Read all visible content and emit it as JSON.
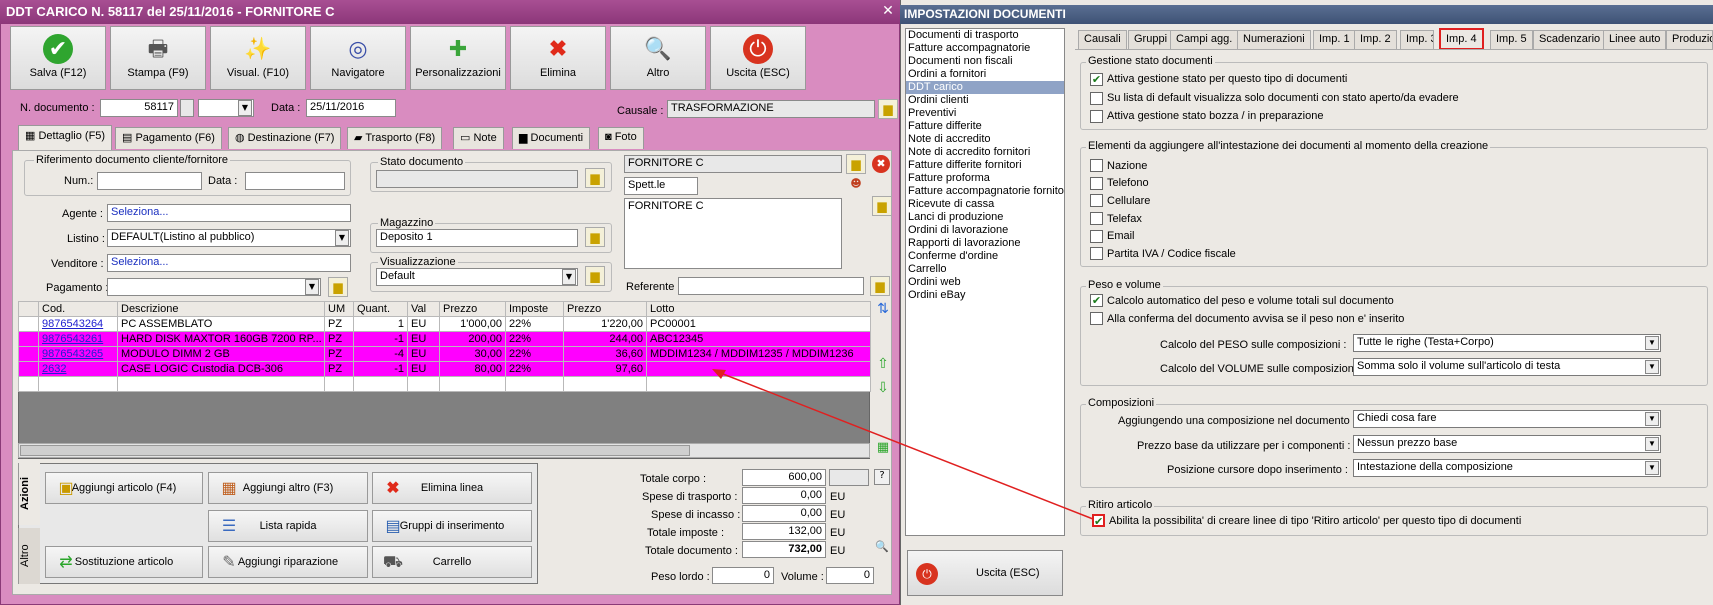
{
  "left": {
    "title": "DDT CARICO N. 58117 del 25/11/2016 - FORNITORE C",
    "close": "✕",
    "toolbar": [
      {
        "label": "Salva (F12)",
        "icon": "check-icon"
      },
      {
        "label": "Stampa (F9)",
        "icon": "printer-icon"
      },
      {
        "label": "Visual. (F10)",
        "icon": "wand-icon"
      },
      {
        "label": "Navigatore",
        "icon": "compass-icon"
      },
      {
        "label": "Personalizzazioni",
        "icon": "puzzle-icon"
      },
      {
        "label": "Elimina",
        "icon": "x-icon"
      },
      {
        "label": "Altro",
        "icon": "magnifier-icon"
      },
      {
        "label": "Uscita (ESC)",
        "icon": "power-icon"
      }
    ],
    "header": {
      "ndoc_label": "N. documento :",
      "ndoc_value": "58117",
      "data_label": "Data :",
      "data_value": "25/11/2016",
      "causale_label": "Causale :",
      "causale_value": "TRASFORMAZIONE"
    },
    "tabs": [
      "Dettaglio (F5)",
      "Pagamento (F6)",
      "Destinazione (F7)",
      "Trasporto (F8)",
      "Note",
      "Documenti",
      "Foto"
    ],
    "rif": {
      "title": "Riferimento documento cliente/fornitore",
      "num_label": "Num.:",
      "data_label": "Data :"
    },
    "agente_label": "Agente :",
    "agente_value": "Seleziona...",
    "listino_label": "Listino :",
    "listino_value": "DEFAULT(Listino al pubblico)",
    "venditore_label": "Venditore :",
    "venditore_value": "Seleziona...",
    "pagamento_label": "Pagamento :",
    "stato_title": "Stato documento",
    "magazzino_title": "Magazzino",
    "magazzino_value": "Deposito 1",
    "visual_title": "Visualizzazione",
    "visual_value": "Default",
    "fornitore_name": "FORNITORE C",
    "spett": "Spett.le",
    "fornitore_addr": "FORNITORE C",
    "referente_label": "Referente :",
    "grid": {
      "headers": [
        "Cod.",
        "Descrizione",
        "UM",
        "Quant.",
        "Val",
        "Prezzo",
        "Imposte",
        "Prezzo",
        "Lotto"
      ],
      "rows": [
        {
          "cod": "9876543264",
          "desc": "PC ASSEMBLATO",
          "um": "PZ",
          "qta": "1",
          "val": "EU",
          "prezzo": "1'000,00",
          "imp": "22%",
          "prezzo2": "1'220,00",
          "lotto": "PC00001",
          "pink": false
        },
        {
          "cod": "9876543261",
          "desc": "HARD DISK MAXTOR 160GB 7200 RP...",
          "um": "PZ",
          "qta": "-1",
          "val": "EU",
          "prezzo": "200,00",
          "imp": "22%",
          "prezzo2": "244,00",
          "lotto": "ABC12345",
          "pink": true
        },
        {
          "cod": "9876543265",
          "desc": "MODULO DIMM 2 GB",
          "um": "PZ",
          "qta": "-4",
          "val": "EU",
          "prezzo": "30,00",
          "imp": "22%",
          "prezzo2": "36,60",
          "lotto": "MDDIM1234 / MDDIM1235 / MDDIM1236",
          "pink": true
        },
        {
          "cod": "2632",
          "desc": "CASE LOGIC Custodia DCB-306",
          "um": "PZ",
          "qta": "-1",
          "val": "EU",
          "prezzo": "80,00",
          "imp": "22%",
          "prezzo2": "97,60",
          "lotto": "",
          "pink": true
        }
      ]
    },
    "azioni_tab": "Azioni",
    "altro_tab": "Altro",
    "actions": [
      {
        "label": "Aggiungi articolo (F4)",
        "icon": "box-add-icon"
      },
      {
        "label": "Aggiungi altro (F3)",
        "icon": "grid-add-icon"
      },
      {
        "label": "Elimina linea",
        "icon": "x-icon"
      },
      {
        "label": "Lista rapida",
        "icon": "list-icon"
      },
      {
        "label": "Gruppi di inserimento",
        "icon": "group-icon"
      },
      {
        "label": "Sostituzione articolo",
        "icon": "swap-icon"
      },
      {
        "label": "Aggiungi riparazione",
        "icon": "wrench-icon"
      },
      {
        "label": "Carrello",
        "icon": "cart-icon"
      }
    ],
    "totals": {
      "corpo_label": "Totale corpo :",
      "corpo": "600,00",
      "trasporto_label": "Spese di trasporto :",
      "trasporto": "0,00",
      "incasso_label": "Spese di incasso :",
      "incasso": "0,00",
      "imposte_label": "Totale imposte :",
      "imposte": "132,00",
      "documento_label": "Totale documento :",
      "documento": "732,00",
      "currency": "EU",
      "peso_label": "Peso lordo :",
      "peso": "0",
      "volume_label": "Volume :",
      "volume": "0"
    }
  },
  "right": {
    "title": "IMPOSTAZIONI DOCUMENTI",
    "list": [
      "Documenti di trasporto",
      "Fatture accompagnatorie",
      "Documenti non fiscali",
      "Ordini a fornitori",
      "DDT carico",
      "Ordini clienti",
      "Preventivi",
      "Fatture differite",
      "Note di accredito",
      "Note di accredito fornitori",
      "Fatture differite fornitori",
      "Fatture proforma",
      "Fatture accompagnatorie fornito",
      "Ricevute di cassa",
      "Lanci di produzione",
      "Ordini di lavorazione",
      "Rapporti di lavorazione",
      "Conferme d'ordine",
      "Carrello",
      "Ordini web",
      "Ordini eBay"
    ],
    "selected_index": 4,
    "tabs": [
      "Causali",
      "Gruppi",
      "Campi agg.",
      "Numerazioni",
      "Imp. 1",
      "Imp. 2",
      "Imp. 3",
      "Imp. 4",
      "Imp. 5",
      "Scadenzario",
      "Linee auto",
      "Produzio"
    ],
    "gestione": {
      "title": "Gestione stato documenti",
      "c1": "Attiva gestione stato per questo tipo di documenti",
      "c2": "Su lista di default visualizza solo documenti con stato aperto/da evadere",
      "c3": "Attiva gestione stato bozza / in preparazione"
    },
    "elementi": {
      "title": "Elementi da aggiungere all'intestazione dei documenti al momento della creazione",
      "items": [
        "Nazione",
        "Telefono",
        "Cellulare",
        "Telefax",
        "Email",
        "Partita IVA / Codice fiscale"
      ]
    },
    "peso": {
      "title": "Peso e volume",
      "c1": "Calcolo automatico del peso e volume totali sul documento",
      "c2": "Alla conferma del documento avvisa se il peso non e' inserito",
      "peso_label": "Calcolo del PESO sulle composizioni :",
      "peso_value": "Tutte le righe (Testa+Corpo)",
      "vol_label": "Calcolo del VOLUME sulle composizioni :",
      "vol_value": "Somma solo il volume sull'articolo di testa"
    },
    "comp": {
      "title": "Composizioni",
      "l1": "Aggiungendo una composizione nel documento :",
      "v1": "Chiedi cosa fare",
      "l2": "Prezzo base da utilizzare per i componenti :",
      "v2": "Nessun prezzo base",
      "l3": "Posizione cursore dopo inserimento :",
      "v3": "Intestazione della composizione"
    },
    "ritiro": {
      "title": "Ritiro articolo",
      "c1": "Abilita la possibilita' di creare linee di tipo 'Ritiro articolo' per questo tipo di documenti"
    },
    "uscita": "Uscita (ESC)"
  },
  "colors": {
    "highlight": "#ff00ff",
    "annotation": "#e02020"
  }
}
